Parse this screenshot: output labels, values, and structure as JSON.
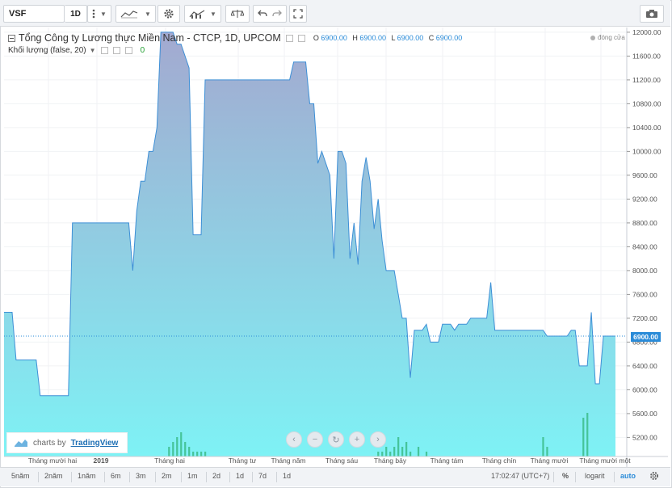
{
  "toolbar": {
    "symbol": "VSF",
    "interval": "1D",
    "icons": [
      "more-icon",
      "line-style-icon",
      "dropdown-icon",
      "settings-gear-icon",
      "indicators-icon",
      "compare-scale-icon",
      "undo-icon",
      "redo-icon",
      "fullscreen-icon",
      "snapshot-camera-icon"
    ]
  },
  "legend": {
    "title": "Tổng Công ty Lương thực Miền Nam - CTCP, 1D, UPCOM",
    "o_label": "O",
    "o_value": "6900.00",
    "h_label": "H",
    "h_value": "6900.00",
    "l_label": "L",
    "l_value": "6900.00",
    "c_label": "C",
    "c_value": "6900.00",
    "volume_label": "Khối lượng (false, 20)",
    "volume_value": "0",
    "market_status": "đóng cửa"
  },
  "colors": {
    "area_top": "#a3a9d0",
    "area_bottom": "#7ef2f5",
    "line": "#3d8fd6",
    "volume": "#3fbf8f",
    "volume_gray": "#9ba3ab",
    "price_tag": "#2a8bd8"
  },
  "last_price_tag": "6900.00",
  "brand": {
    "prefix": "charts by",
    "name": "TradingView"
  },
  "nav_buttons": [
    "‹",
    "−",
    "↻",
    "+",
    "›"
  ],
  "bottom": {
    "ranges": [
      "5năm",
      "2năm",
      "1năm",
      "6m",
      "3m",
      "2m",
      "1m",
      "2d",
      "1d",
      "7d",
      "1d"
    ],
    "time": "17:02:47",
    "timezone": "(UTC+7)",
    "percent": "%",
    "log": "logarit",
    "auto": "auto"
  },
  "chart_data": {
    "type": "area",
    "title": "Tổng Công ty Lương thực Miền Nam - CTCP, 1D, UPCOM",
    "ylim": [
      4880,
      12080
    ],
    "y_ticks": [
      5200,
      5600,
      6000,
      6400,
      6800,
      7200,
      7600,
      8000,
      8400,
      8800,
      9200,
      9600,
      10000,
      10400,
      10800,
      11200,
      11600,
      12000
    ],
    "y_tick_labels": [
      "5200.00",
      "5600.00",
      "6000.00",
      "6400.00",
      "6800.00",
      "7200.00",
      "7600.00",
      "8000.00",
      "8400.00",
      "8800.00",
      "9200.00",
      "9600.00",
      "10000.00",
      "10400.00",
      "10800.00",
      "11200.00",
      "11600.00",
      "12000.00"
    ],
    "x_tick_labels": [
      "Tháng mười hai",
      "2019",
      "Tháng hai",
      "Tháng tư",
      "Tháng năm",
      "Tháng sáu",
      "Tháng bảy",
      "Tháng tám",
      "Tháng chín",
      "Tháng mười",
      "Tháng mười một"
    ],
    "grid": true,
    "series": [
      {
        "values": [
          7300,
          7300,
          7300,
          6500,
          6500,
          6500,
          6500,
          6500,
          6500,
          5900,
          5900,
          5900,
          5900,
          5900,
          5900,
          5900,
          5900,
          8800,
          8800,
          8800,
          8800,
          8800,
          8800,
          8800,
          8800,
          8800,
          8800,
          8800,
          8800,
          8800,
          8800,
          8800,
          8000,
          9000,
          9500,
          9500,
          10000,
          10000,
          10400,
          12000,
          12000,
          12000,
          12000,
          11800,
          11800,
          11600,
          11400,
          8600,
          8600,
          8600,
          11200,
          11200,
          11200,
          11200,
          11200,
          11200,
          11200,
          11200,
          11200,
          11200,
          11200,
          11200,
          11200,
          11200,
          11200,
          11200,
          11200,
          11200,
          11200,
          11200,
          11200,
          11200,
          11500,
          11500,
          11500,
          11500,
          10800,
          10800,
          9800,
          10000,
          9800,
          9600,
          8200,
          10000,
          10000,
          9800,
          8200,
          8800,
          8100,
          9500,
          9900,
          9500,
          8700,
          9200,
          8500,
          8000,
          8000,
          8000,
          7600,
          7200,
          7200,
          6200,
          7000,
          7000,
          7000,
          7100,
          6800,
          6800,
          6800,
          7100,
          7100,
          7100,
          7000,
          7100,
          7100,
          7100,
          7200,
          7200,
          7200,
          7200,
          7200,
          7800,
          7000,
          7000,
          7000,
          7000,
          7000,
          7000,
          7000,
          7000,
          7000,
          7000,
          7000,
          7000,
          7000,
          6900,
          6900,
          6900,
          6900,
          6900,
          6900,
          7000,
          7000,
          6400,
          6400,
          6400,
          7300,
          6100,
          6100,
          6900,
          6900,
          6900,
          6900
        ]
      }
    ],
    "volume": {
      "label": "Khối lượng (false, 20)",
      "values": [
        0,
        0,
        0,
        0,
        0,
        0,
        0,
        0,
        0,
        0,
        0,
        0,
        0,
        0,
        0,
        0,
        0,
        0,
        0,
        0,
        0,
        0,
        0,
        0,
        0,
        0,
        0,
        0,
        0,
        0,
        0,
        0,
        0,
        0,
        0,
        0,
        0,
        0,
        0,
        0,
        0,
        2,
        3,
        4,
        5,
        3,
        2,
        1,
        1,
        1,
        1,
        0,
        0,
        0,
        0,
        0,
        0,
        0,
        0,
        0,
        0,
        0,
        0,
        0,
        0,
        0,
        0,
        0,
        0,
        0,
        0,
        0,
        0,
        0,
        0,
        0,
        0,
        0,
        0,
        0,
        0,
        0,
        0,
        0,
        0,
        0,
        0,
        0,
        0,
        0,
        0,
        0,
        0,
        1,
        1,
        2,
        1,
        2,
        4,
        2,
        3,
        1,
        0,
        2,
        0,
        1,
        0,
        0,
        0,
        0,
        0,
        0,
        0,
        0,
        0,
        0,
        0,
        0,
        0,
        0,
        0,
        0,
        0,
        0,
        0,
        0,
        0,
        0,
        0,
        0,
        0,
        0,
        0,
        0,
        4,
        2,
        0,
        0,
        0,
        0,
        0,
        0,
        0,
        0,
        8,
        9,
        0,
        0,
        0,
        0,
        0
      ]
    }
  }
}
